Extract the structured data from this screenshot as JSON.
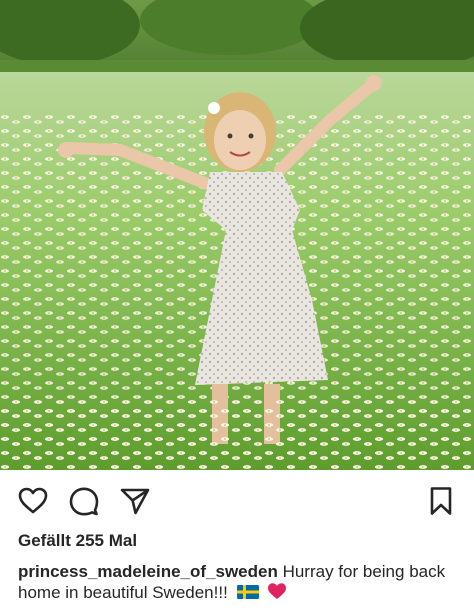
{
  "post": {
    "image_description_icon": "photo",
    "likes_text": "Gefällt 255 Mal",
    "caption": {
      "username": "princess_madeleine_of_sweden",
      "text": "Hurray for being back home in beautiful Sweden!!!"
    }
  },
  "actions": {
    "like_icon": "heart-outline-icon",
    "comment_icon": "comment-bubble-icon",
    "share_icon": "paper-plane-icon",
    "save_icon": "bookmark-icon"
  },
  "colors": {
    "text": "#262626",
    "background": "#ffffff",
    "heart_emoji": "#e0245e",
    "flag_blue": "#006aa7",
    "flag_yellow": "#fecc00"
  }
}
